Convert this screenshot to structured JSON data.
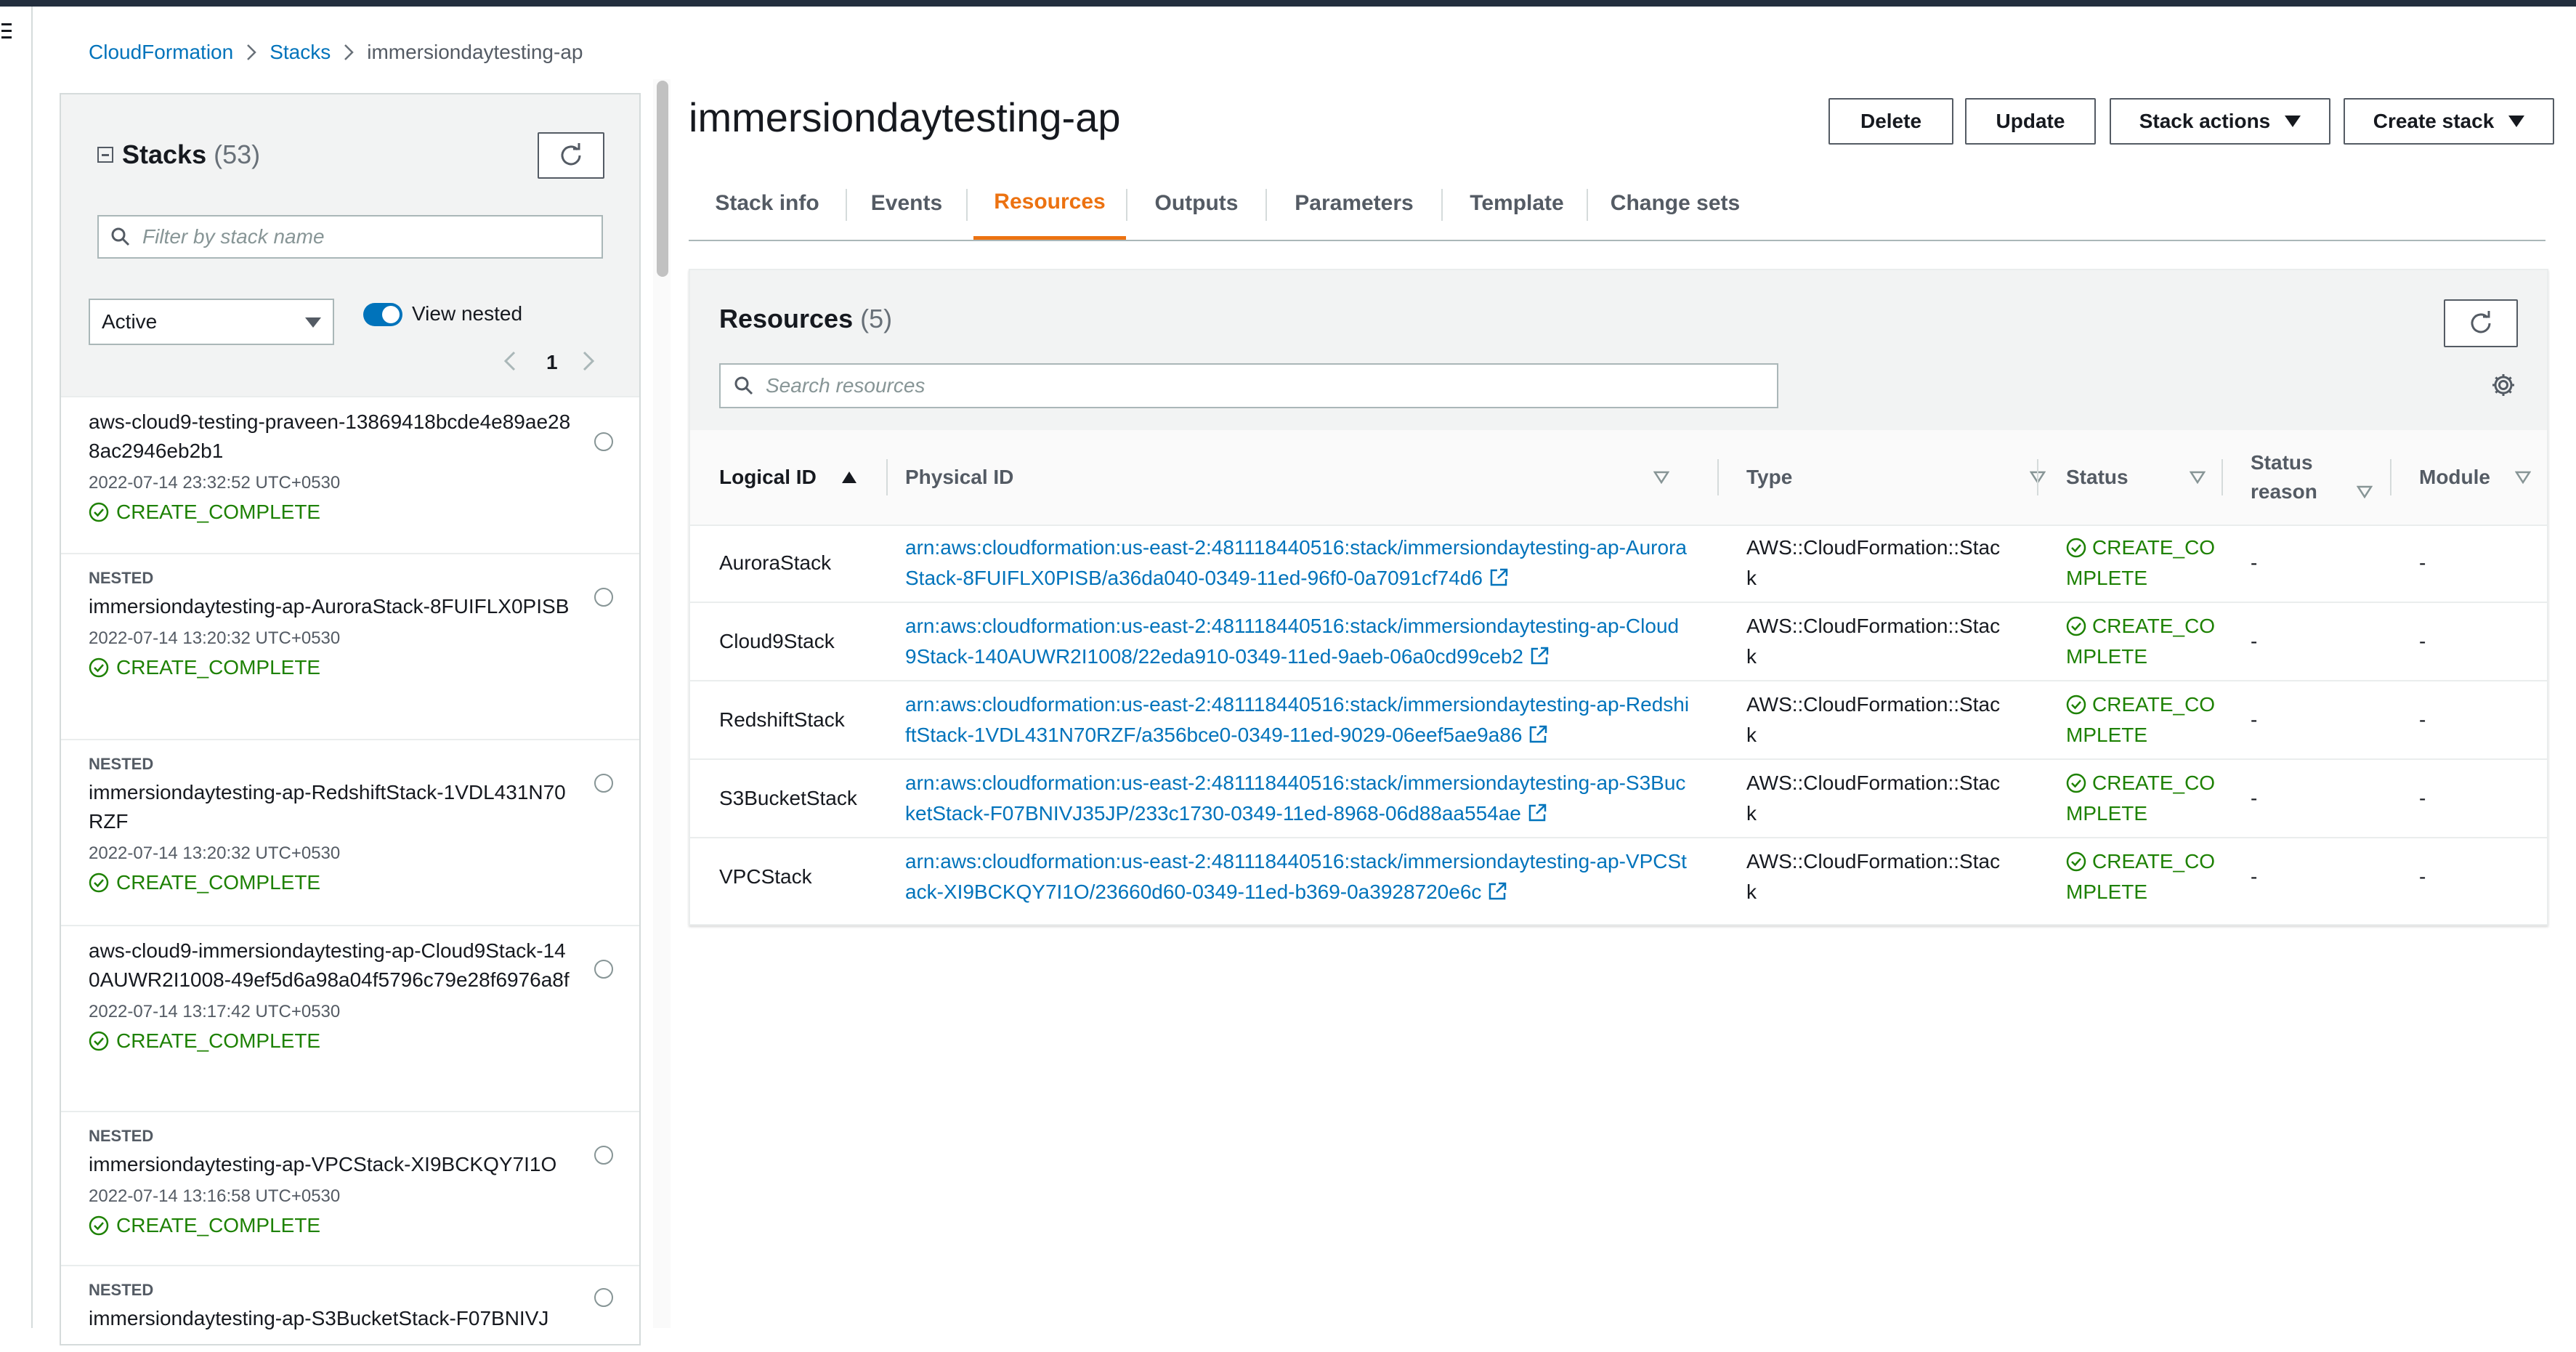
{
  "breadcrumb": {
    "root": "CloudFormation",
    "stacks": "Stacks",
    "current": "immersiondaytesting-ap"
  },
  "sidebar": {
    "title": "Stacks",
    "count": "(53)",
    "filter_placeholder": "Filter by stack name",
    "status_select": "Active",
    "view_nested_label": "View nested",
    "view_nested_on": true,
    "page": "1",
    "stacks": [
      {
        "nested": "",
        "name": "aws-cloud9-testing-praveen-13869418bcde4e89ae288ac2946eb2b1",
        "date": "2022-07-14 23:32:52 UTC+0530",
        "status": "CREATE_COMPLETE"
      },
      {
        "nested": "NESTED",
        "name": "immersiondaytesting-ap-AuroraStack-8FUIFLX0PISB",
        "date": "2022-07-14 13:20:32 UTC+0530",
        "status": "CREATE_COMPLETE"
      },
      {
        "nested": "NESTED",
        "name": "immersiondaytesting-ap-RedshiftStack-1VDL431N70RZF",
        "date": "2022-07-14 13:20:32 UTC+0530",
        "status": "CREATE_COMPLETE"
      },
      {
        "nested": "",
        "name": "aws-cloud9-immersiondaytesting-ap-Cloud9Stack-140AUWR2I1008-49ef5d6a98a04f5796c79e28f6976a8f",
        "date": "2022-07-14 13:17:42 UTC+0530",
        "status": "CREATE_COMPLETE"
      },
      {
        "nested": "NESTED",
        "name": "immersiondaytesting-ap-VPCStack-XI9BCKQY7I1O",
        "date": "2022-07-14 13:16:58 UTC+0530",
        "status": "CREATE_COMPLETE"
      },
      {
        "nested": "NESTED",
        "name": "immersiondaytesting-ap-S3BucketStack-F07BNIVJ",
        "date": "",
        "status": ""
      }
    ]
  },
  "page": {
    "title": "immersiondaytesting-ap",
    "buttons": {
      "delete": "Delete",
      "update": "Update",
      "stack_actions": "Stack actions",
      "create_stack": "Create stack"
    },
    "tabs": [
      "Stack info",
      "Events",
      "Resources",
      "Outputs",
      "Parameters",
      "Template",
      "Change sets"
    ],
    "active_tab": "Resources"
  },
  "resources": {
    "title": "Resources",
    "count": "(5)",
    "search_placeholder": "Search resources",
    "columns": {
      "logical_id": "Logical ID",
      "physical_id": "Physical ID",
      "type": "Type",
      "status": "Status",
      "status_reason": "Status reason",
      "module": "Module"
    },
    "rows": [
      {
        "logical_id": "AuroraStack",
        "physical_id": "arn:aws:cloudformation:us-east-2:481118440516:stack/immersiondaytesting-ap-AuroraStack-8FUIFLX0PISB/a36da040-0349-11ed-96f0-0a7091cf74d6",
        "type": "AWS::CloudFormation::Stack",
        "status": "CREATE_COMPLETE",
        "status_reason": "-",
        "module": "-"
      },
      {
        "logical_id": "Cloud9Stack",
        "physical_id": "arn:aws:cloudformation:us-east-2:481118440516:stack/immersiondaytesting-ap-Cloud9Stack-140AUWR2I1008/22eda910-0349-11ed-9aeb-06a0cd99ceb2",
        "type": "AWS::CloudFormation::Stack",
        "status": "CREATE_COMPLETE",
        "status_reason": "-",
        "module": "-"
      },
      {
        "logical_id": "RedshiftStack",
        "physical_id": "arn:aws:cloudformation:us-east-2:481118440516:stack/immersiondaytesting-ap-RedshiftStack-1VDL431N70RZF/a356bce0-0349-11ed-9029-06eef5ae9a86",
        "type": "AWS::CloudFormation::Stack",
        "status": "CREATE_COMPLETE",
        "status_reason": "-",
        "module": "-"
      },
      {
        "logical_id": "S3BucketStack",
        "physical_id": "arn:aws:cloudformation:us-east-2:481118440516:stack/immersiondaytesting-ap-S3BucketStack-F07BNIVJ35JP/233c1730-0349-11ed-8968-06d88aa554ae",
        "type": "AWS::CloudFormation::Stack",
        "status": "CREATE_COMPLETE",
        "status_reason": "-",
        "module": "-"
      },
      {
        "logical_id": "VPCStack",
        "physical_id": "arn:aws:cloudformation:us-east-2:481118440516:stack/immersiondaytesting-ap-VPCStack-XI9BCKQY7I1O/23660d60-0349-11ed-b369-0a3928720e6c",
        "type": "AWS::CloudFormation::Stack",
        "status": "CREATE_COMPLETE",
        "status_reason": "-",
        "module": "-"
      }
    ]
  },
  "colors": {
    "link": "#0073bb",
    "success": "#1d8102",
    "active_tab": "#ec7211",
    "toggle_on": "#0073bb",
    "header_bar": "#232f3e"
  },
  "icons": {
    "menu": "hamburger-icon",
    "refresh": "refresh-icon",
    "search": "search-icon",
    "settings": "gear-icon",
    "status_ok": "check-circle-icon",
    "external_link": "external-link-icon"
  }
}
